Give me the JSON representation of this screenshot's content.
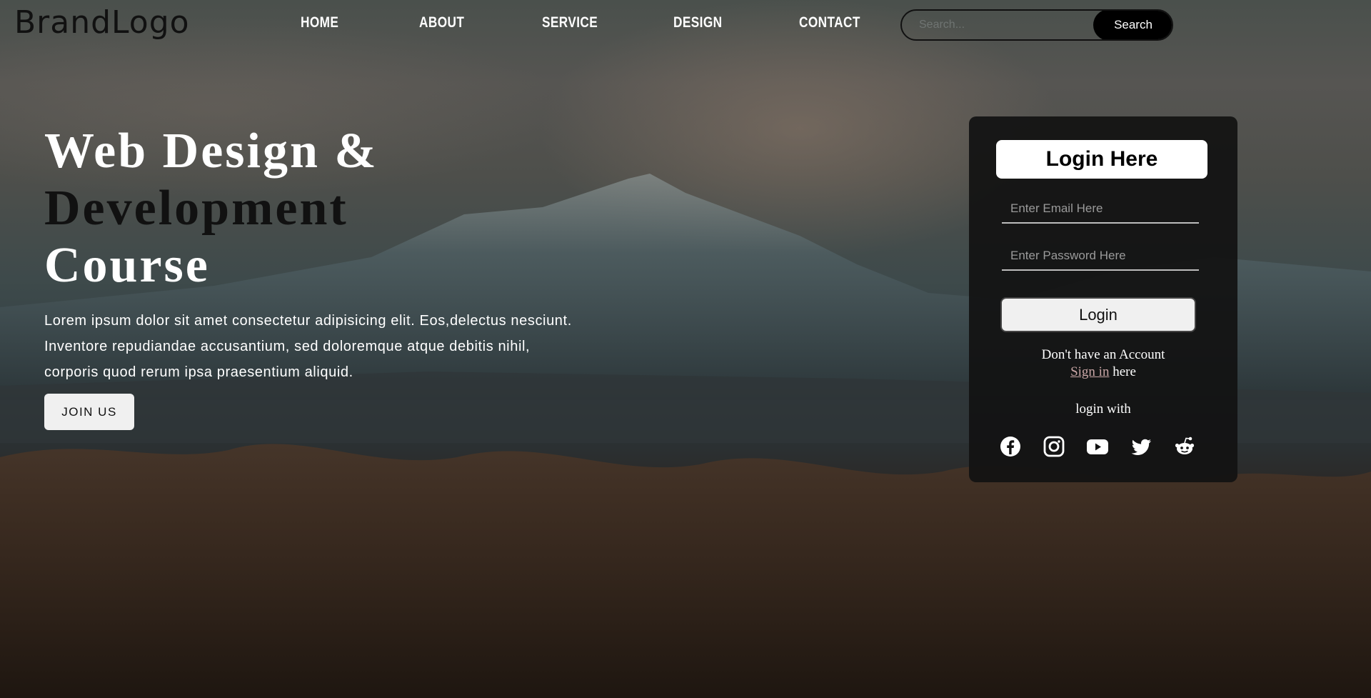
{
  "nav": {
    "brand": "BrandLogo",
    "links": [
      "HOME",
      "ABOUT",
      "SERVICE",
      "DESIGN",
      "CONTACT"
    ],
    "search_placeholder": "Search...",
    "search_button": "Search"
  },
  "hero": {
    "title_line1": "Web Design &",
    "title_line2": "Development",
    "title_line3": "Course",
    "text_line1": "Lorem ipsum dolor sit amet consectetur adipisicing elit. Eos,delectus nesciunt.",
    "text_line2": "Inventore repudiandae accusantium, sed doloremque atque debitis nihil,",
    "text_line3": "corporis quod rerum ipsa praesentium aliquid.",
    "join_button": "JOIN US"
  },
  "login": {
    "title": "Login Here",
    "email_placeholder": "Enter Email Here",
    "password_placeholder": "Enter Password Here",
    "login_button": "Login",
    "no_account": "Don't have an Account",
    "sign_in_link": "Sign in",
    "sign_in_suffix": " here",
    "login_with": "login with",
    "social_icons": [
      "facebook-icon",
      "instagram-icon",
      "youtube-icon",
      "twitter-icon",
      "reddit-icon"
    ]
  },
  "colors": {
    "card_bg": "#121212",
    "accent_link": "#c9a6a6",
    "button_bg": "#f0f0f0",
    "search_button_bg": "#000000"
  }
}
